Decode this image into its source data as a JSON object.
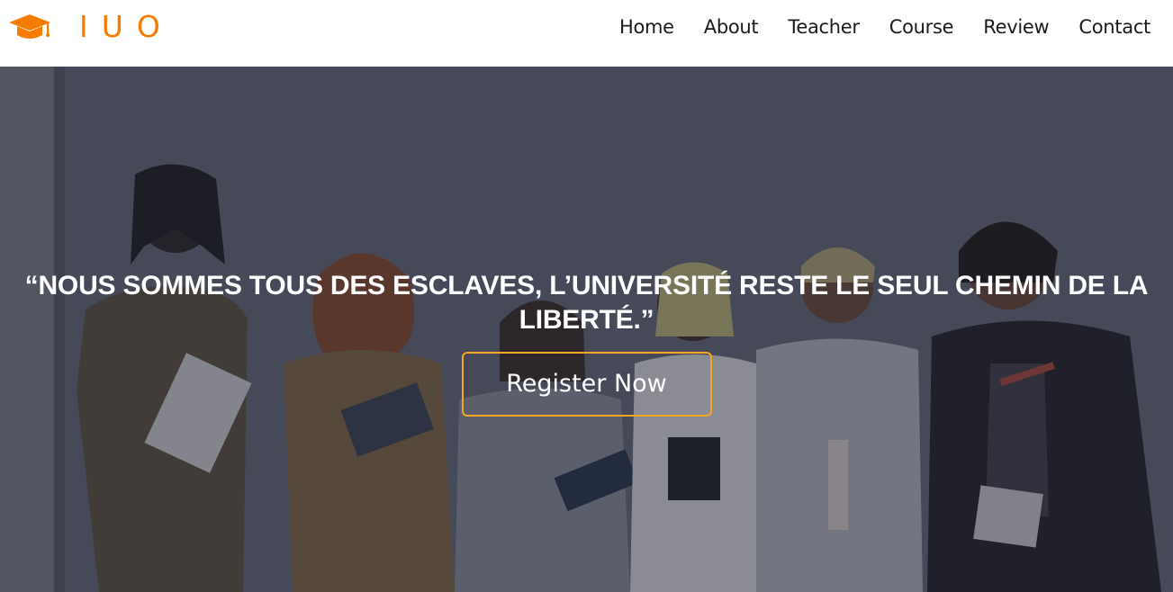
{
  "brand": {
    "name": "IUO",
    "icon": "graduation-cap-icon",
    "accent_color": "#f57c00"
  },
  "nav": {
    "items": [
      {
        "label": "Home"
      },
      {
        "label": "About"
      },
      {
        "label": "Teacher"
      },
      {
        "label": "Course"
      },
      {
        "label": "Review"
      },
      {
        "label": "Contact"
      }
    ]
  },
  "hero": {
    "quote": "“NOUS SOMMES TOUS DES ESCLAVES, L’UNIVERSITÉ RESTE LE SEUL CHEMIN DE LA LIBERTÉ.”",
    "cta_label": "Register Now",
    "cta_border_color": "#f5a623",
    "background": "group-of-students-photo"
  }
}
